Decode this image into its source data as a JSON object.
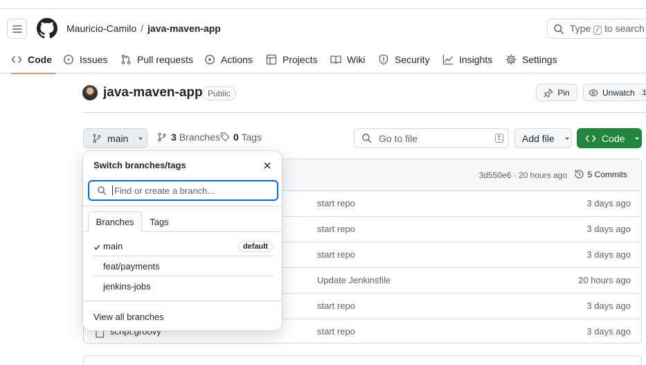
{
  "header": {
    "owner": "Mauricio-Camilo",
    "separator": "/",
    "repo": "java-maven-app",
    "search_prefix": "Type",
    "search_key": "/",
    "search_suffix": "to search"
  },
  "nav": {
    "code": "Code",
    "issues": "Issues",
    "pulls": "Pull requests",
    "actions": "Actions",
    "projects": "Projects",
    "wiki": "Wiki",
    "security": "Security",
    "insights": "Insights",
    "settings": "Settings"
  },
  "repo": {
    "title": "java-maven-app",
    "visibility": "Public",
    "pin_label": "Pin",
    "watch_label": "Unwatch",
    "watch_count": "1"
  },
  "branchbar": {
    "current_branch": "main",
    "branches_count": "3",
    "branches_label": "Branches",
    "tags_count": "0",
    "tags_label": "Tags",
    "goto_placeholder": "Go to file",
    "goto_key": "t",
    "add_file": "Add file",
    "code_button": "Code"
  },
  "commit": {
    "meta": "3d550e6 · 20 hours ago",
    "commits_label": "5 Commits"
  },
  "files": [
    {
      "name": "",
      "message": "start repo",
      "age": "3 days ago"
    },
    {
      "name": "",
      "message": "start repo",
      "age": "3 days ago"
    },
    {
      "name": "",
      "message": "start repo",
      "age": "3 days ago"
    },
    {
      "name": "",
      "message": "Update Jenkinsfile",
      "age": "20 hours ago"
    },
    {
      "name": "",
      "message": "start repo",
      "age": "3 days ago"
    },
    {
      "name": "script.groovy",
      "message": "start repo",
      "age": "3 days ago"
    }
  ],
  "menu": {
    "title": "Switch branches/tags",
    "filter_placeholder": "Find or create a branch...",
    "tab_branches": "Branches",
    "tab_tags": "Tags",
    "branches": [
      {
        "name": "main",
        "badge": "default"
      },
      {
        "name": "feat/payments"
      },
      {
        "name": "jenkins-jobs"
      }
    ],
    "view_all": "View all branches"
  },
  "colors": {
    "accent_blue": "#0969da",
    "primary_green": "#1f883d",
    "active_underline": "#fd8c73"
  }
}
